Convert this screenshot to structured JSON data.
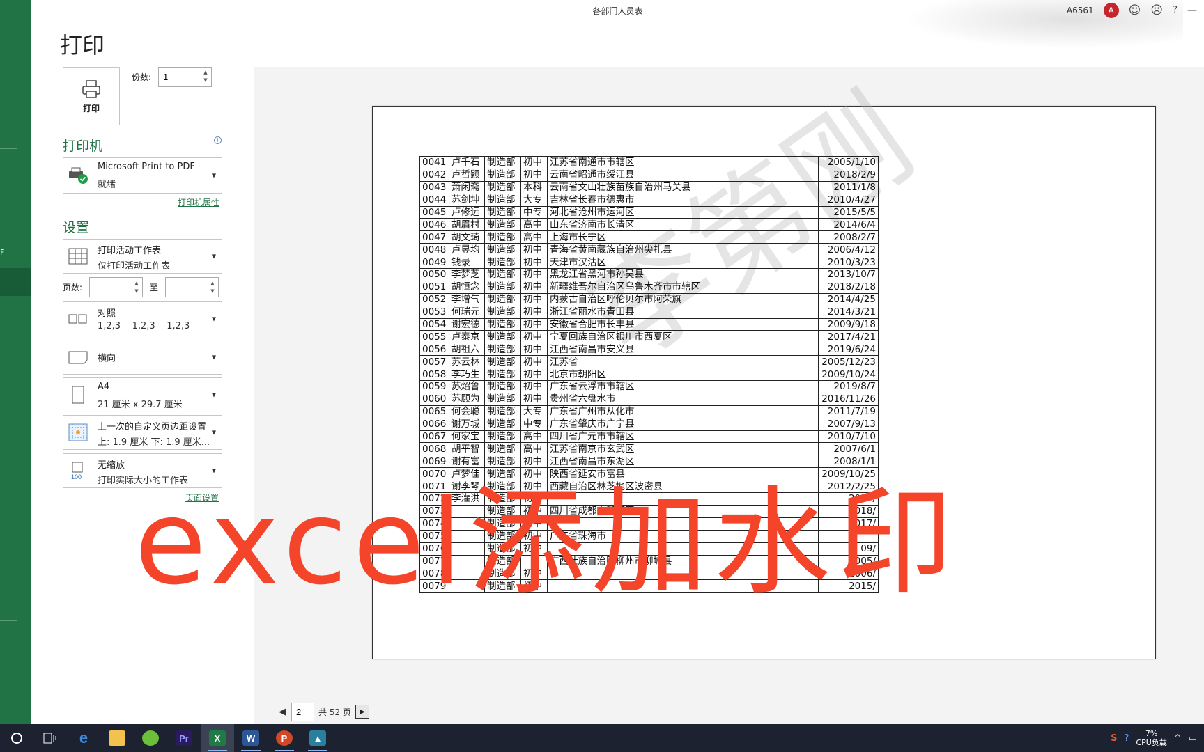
{
  "window": {
    "doc_title": "各部门人员表",
    "user_id": "A6561",
    "avatar_letter": "A"
  },
  "nav": {
    "truncated_label": "F"
  },
  "print_panel": {
    "title": "打印",
    "print_button": "打印",
    "copies_label": "份数:",
    "copies_value": "1",
    "printer_heading": "打印机",
    "printer_name": "Microsoft Print to PDF",
    "printer_status": "就绪",
    "printer_props_link": "打印机属性",
    "settings_heading": "设置",
    "scope_l1": "打印活动工作表",
    "scope_l2": "仅打印活动工作表",
    "pages_label": "页数:",
    "pages_to": "至",
    "collate_l1": "对照",
    "collate_l2": "1,2,3    1,2,3    1,2,3",
    "orientation": "横向",
    "paper_l1": "A4",
    "paper_l2": "21 厘米 x 29.7 厘米",
    "margin_l1": "上一次的自定义页边距设置",
    "margin_l2": "上: 1.9 厘米 下: 1.9 厘米...",
    "scale_l1": "无缩放",
    "scale_l2": "打印实际大小的工作表",
    "page_setup_link": "页面设置"
  },
  "preview": {
    "ghost_watermark": "李第刚",
    "overlay_title": "excel添加水印",
    "rows": [
      [
        "0041",
        "卢千石",
        "制造部",
        "初中",
        "江苏省南通市市辖区",
        "2005/1/10"
      ],
      [
        "0042",
        "卢哲颢",
        "制造部",
        "初中",
        "云南省昭通市绥江县",
        "2018/2/9"
      ],
      [
        "0043",
        "萧闲斋",
        "制造部",
        "本科",
        "云南省文山壮族苗族自治州马关县",
        "2011/1/8"
      ],
      [
        "0044",
        "苏剑坤",
        "制造部",
        "大专",
        "吉林省长春市德惠市",
        "2010/4/27"
      ],
      [
        "0045",
        "卢修远",
        "制造部",
        "中专",
        "河北省沧州市运河区",
        "2015/5/5"
      ],
      [
        "0046",
        "胡眉村",
        "制造部",
        "高中",
        "山东省济南市长清区",
        "2014/6/4"
      ],
      [
        "0047",
        "胡文琦",
        "制造部",
        "高中",
        "上海市长宁区",
        "2008/2/7"
      ],
      [
        "0048",
        "卢昱均",
        "制造部",
        "初中",
        "青海省黄南藏族自治州尖扎县",
        "2006/4/12"
      ],
      [
        "0049",
        "钱录",
        "制造部",
        "初中",
        "天津市汉沽区",
        "2010/3/23"
      ],
      [
        "0050",
        "李梦芝",
        "制造部",
        "初中",
        "黑龙江省黑河市孙吴县",
        "2013/10/7"
      ],
      [
        "0051",
        "胡恒念",
        "制造部",
        "初中",
        "新疆维吾尔自治区乌鲁木齐市市辖区",
        "2018/2/18"
      ],
      [
        "0052",
        "李增气",
        "制造部",
        "初中",
        "内蒙古自治区呼伦贝尔市阿荣旗",
        "2014/4/25"
      ],
      [
        "0053",
        "何瑞元",
        "制造部",
        "初中",
        "浙江省丽水市青田县",
        "2014/3/21"
      ],
      [
        "0054",
        "谢宏德",
        "制造部",
        "初中",
        "安徽省合肥市长丰县",
        "2009/9/18"
      ],
      [
        "0055",
        "卢泰京",
        "制造部",
        "初中",
        "宁夏回族自治区银川市西夏区",
        "2017/4/21"
      ],
      [
        "0056",
        "胡祖六",
        "制造部",
        "初中",
        "江西省南昌市安义县",
        "2019/6/24"
      ],
      [
        "0057",
        "苏云林",
        "制造部",
        "初中",
        "江苏省",
        "2005/12/23"
      ],
      [
        "0058",
        "李巧生",
        "制造部",
        "初中",
        "北京市朝阳区",
        "2009/10/24"
      ],
      [
        "0059",
        "苏炤鲁",
        "制造部",
        "初中",
        "广东省云浮市市辖区",
        "2019/8/7"
      ],
      [
        "0060",
        "苏顾为",
        "制造部",
        "初中",
        "贵州省六盘水市",
        "2016/11/26"
      ],
      [
        "0065",
        "何会聪",
        "制造部",
        "大专",
        "广东省广州市从化市",
        "2011/7/19"
      ],
      [
        "0066",
        "谢万城",
        "制造部",
        "中专",
        "广东省肇庆市广宁县",
        "2007/9/13"
      ],
      [
        "0067",
        "何家宝",
        "制造部",
        "高中",
        "四川省广元市市辖区",
        "2010/7/10"
      ],
      [
        "0068",
        "胡平智",
        "制造部",
        "高中",
        "江苏省南京市玄武区",
        "2007/6/1"
      ],
      [
        "0069",
        "谢有富",
        "制造部",
        "初中",
        "江西省南昌市东湖区",
        "2008/1/1"
      ],
      [
        "0070",
        "卢梦佳",
        "制造部",
        "初中",
        "陕西省延安市富县",
        "2009/10/25"
      ],
      [
        "0071",
        "谢李琴",
        "制造部",
        "初中",
        "西藏自治区林芝地区波密县",
        "2012/2/25"
      ],
      [
        "0072",
        "李灌洪",
        "制造部",
        "初中",
        "",
        "2012/"
      ],
      [
        "0073",
        "",
        "制造部",
        "初中",
        "四川省成都市新都区",
        "2018/"
      ],
      [
        "0074",
        "",
        "制造部",
        "初中",
        "",
        "2017/"
      ],
      [
        "0075",
        "",
        "制造部",
        "初中",
        "广东省珠海市",
        ""
      ],
      [
        "0076",
        "",
        "制造部",
        "初中",
        "",
        "09/"
      ],
      [
        "0077",
        "",
        "制造部",
        "",
        "广西壮族自治区柳州市柳城县",
        "2005/"
      ],
      [
        "0078",
        "",
        "制造部",
        "初中",
        "",
        "2006/"
      ],
      [
        "0079",
        "",
        "制造部",
        "初中",
        "",
        "2015/"
      ]
    ]
  },
  "pager": {
    "current_page": "2",
    "total_label": "共 52 页"
  },
  "tray": {
    "cpu_pct": "7%",
    "cpu_label": "CPU负载"
  },
  "colors": {
    "excel_green": "#217346",
    "overlay_red": "#f4442a",
    "taskbar_bg": "#1c2230"
  }
}
